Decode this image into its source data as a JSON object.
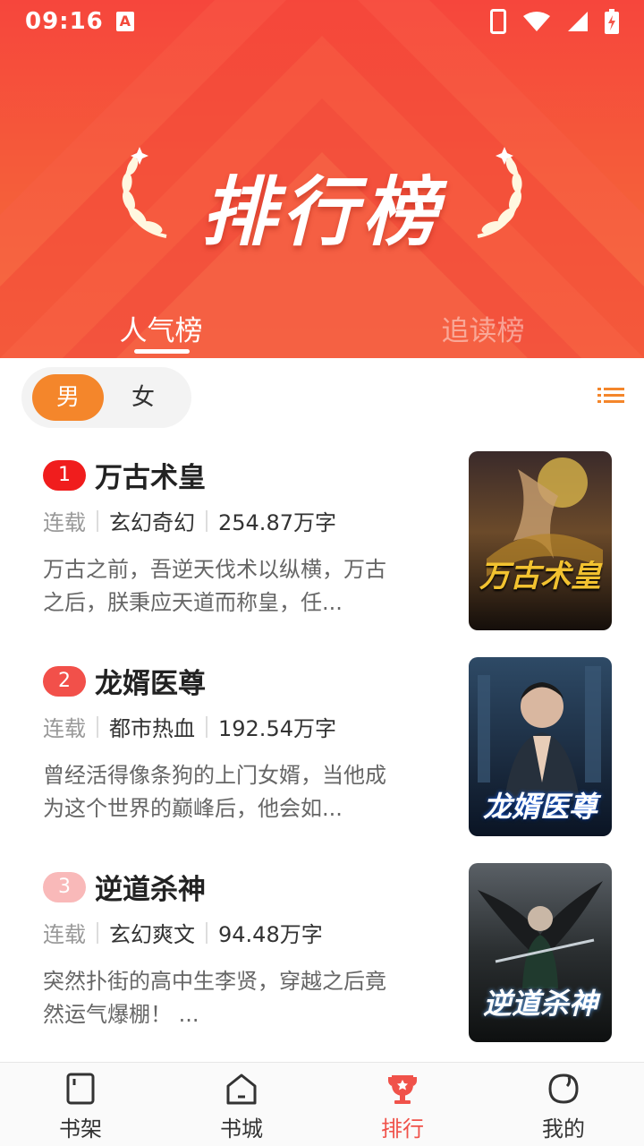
{
  "status_bar": {
    "time": "09:16",
    "notification_badge": "A"
  },
  "banner": {
    "title": "排行榜"
  },
  "tabs": [
    {
      "label": "人气榜",
      "active": true
    },
    {
      "label": "追读榜",
      "active": false
    }
  ],
  "gender_toggle": {
    "options": [
      "男",
      "女"
    ],
    "selected": "男"
  },
  "books": [
    {
      "rank": "1",
      "title": "万古术皇",
      "status": "连载",
      "genre": "玄幻奇幻",
      "words": "254.87万字",
      "description": "万古之前，吾逆天伐术以纵横，万古之后，朕秉应天道而称皇，任...",
      "cover_text": "万古术皇",
      "rank_color": "#f01d1d"
    },
    {
      "rank": "2",
      "title": "龙婿医尊",
      "status": "连载",
      "genre": "都市热血",
      "words": "192.54万字",
      "description": "曾经活得像条狗的上门女婿，当他成为这个世界的巅峰后，他会如...",
      "cover_text": "龙婿医尊",
      "rank_color": "#f2504a"
    },
    {
      "rank": "3",
      "title": "逆道杀神",
      "status": "连载",
      "genre": "玄幻爽文",
      "words": "94.48万字",
      "description": "突然扑街的高中生李贤，穿越之后竟然运气爆棚！ ...",
      "cover_text": "逆道杀神",
      "rank_color": "#f9b9b9"
    }
  ],
  "bottom_nav": [
    {
      "label": "书架",
      "icon": "bookshelf-icon",
      "active": false
    },
    {
      "label": "书城",
      "icon": "bookstore-icon",
      "active": false
    },
    {
      "label": "排行",
      "icon": "trophy-icon",
      "active": true
    },
    {
      "label": "我的",
      "icon": "profile-icon",
      "active": false
    }
  ],
  "colors": {
    "accent": "#f0524a",
    "toggle_active": "#f4862b",
    "banner_top": "#f6463c",
    "banner_bottom": "#f5703c"
  }
}
